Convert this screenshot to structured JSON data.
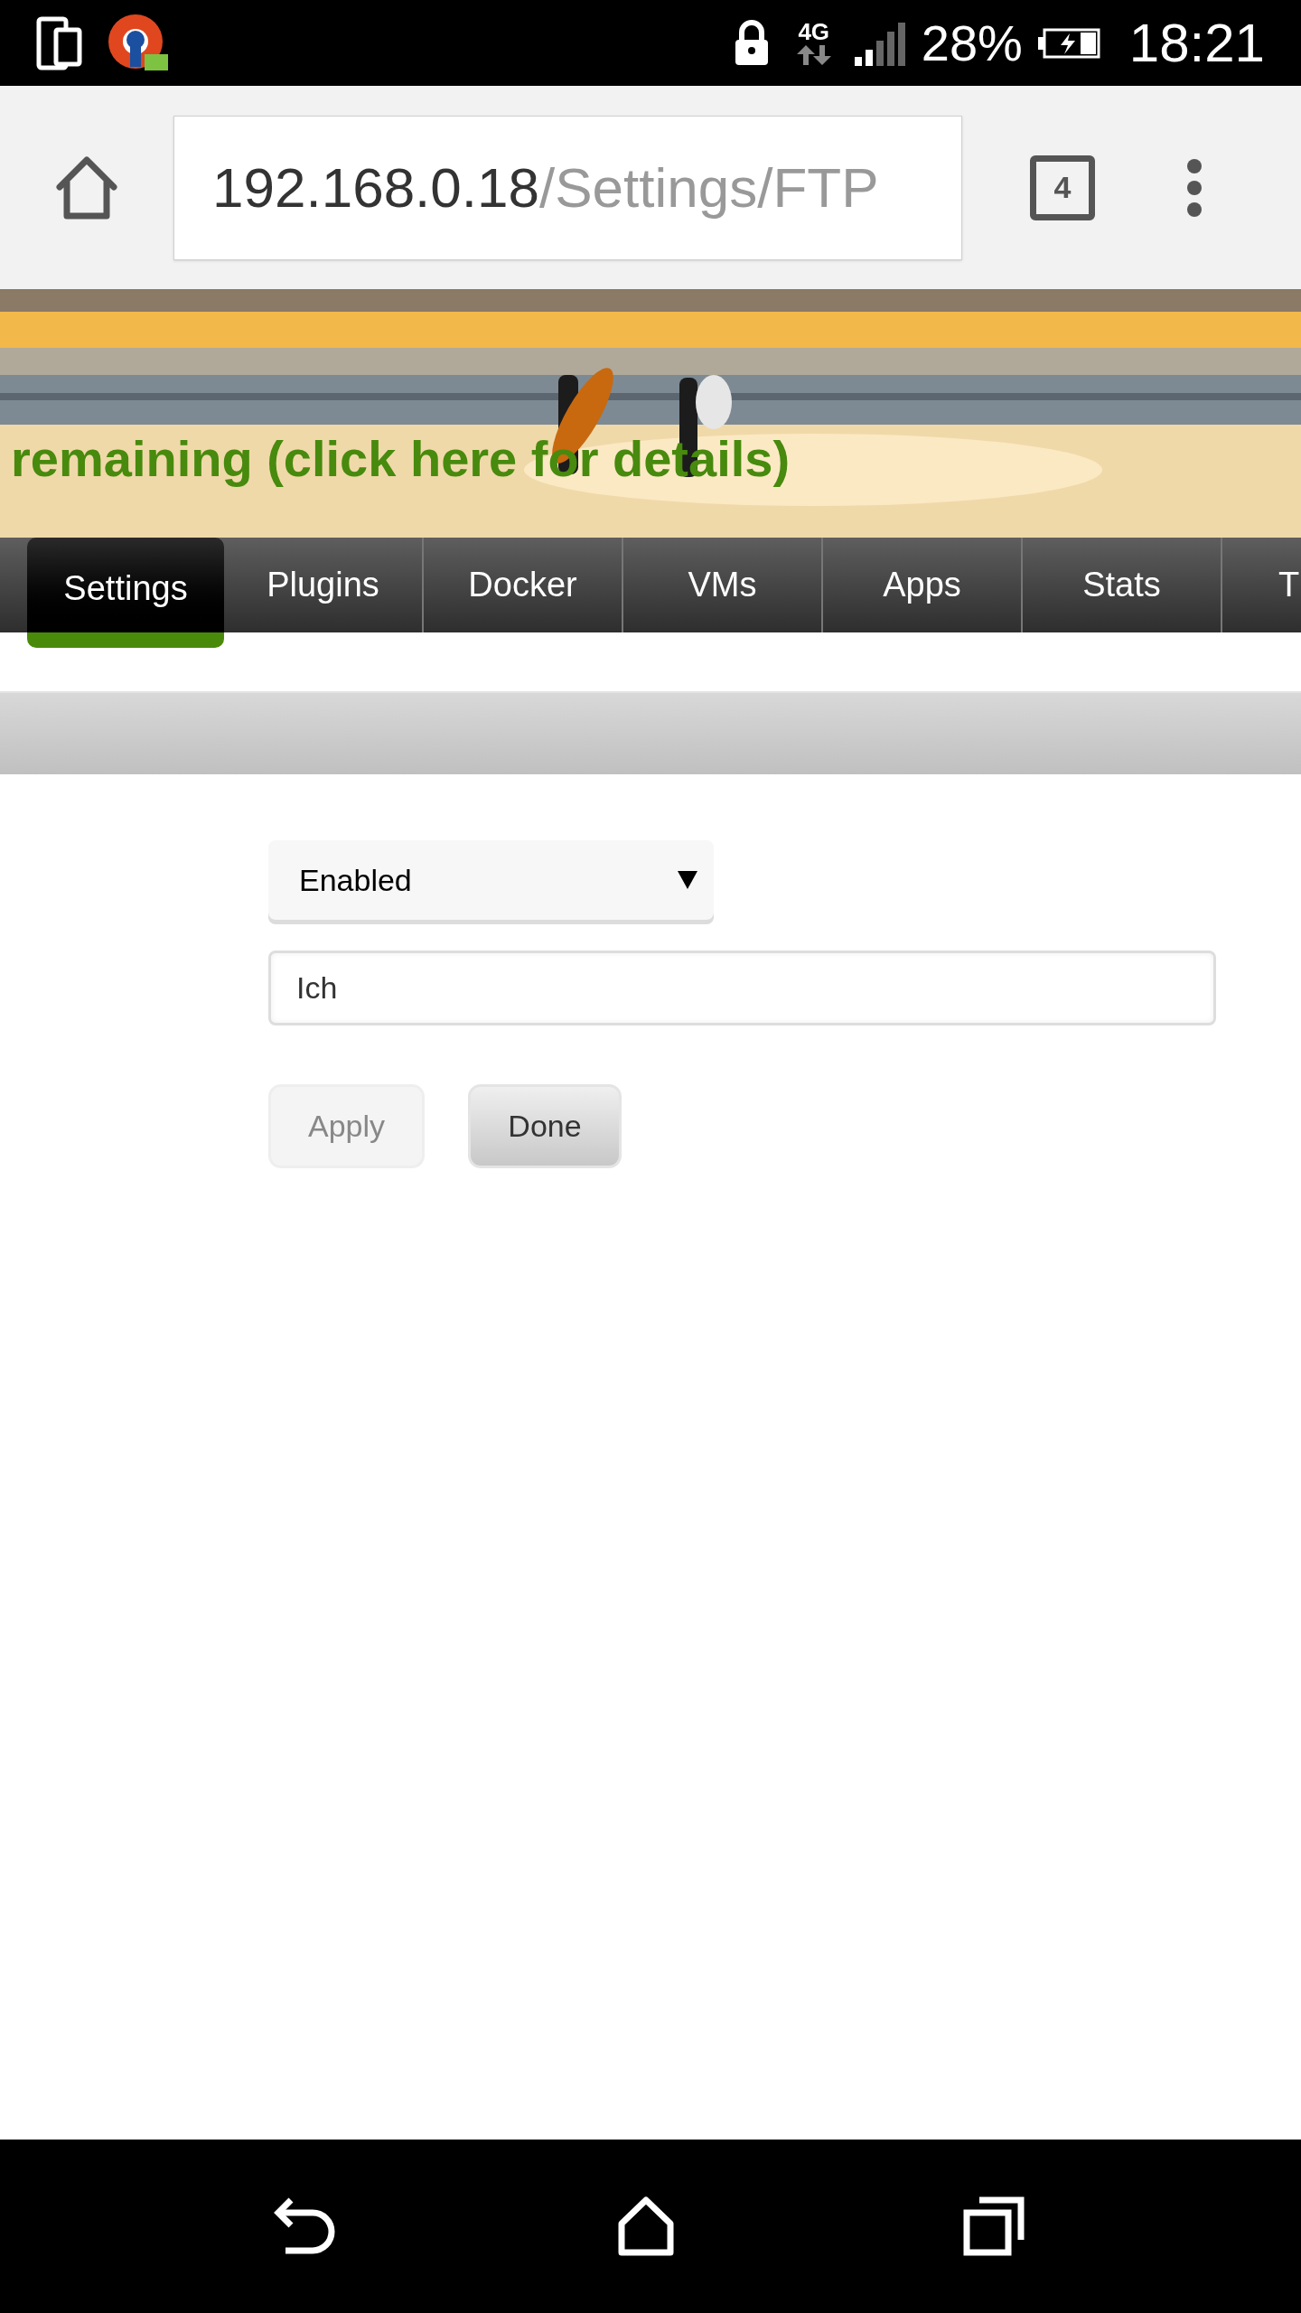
{
  "status_bar": {
    "network": "4G",
    "battery": "28%",
    "time": "18:21"
  },
  "browser": {
    "url_host": "192.168.0.18",
    "url_path": "/Settings/FTP",
    "tab_count": "4"
  },
  "banner": {
    "kind": "picture",
    "notice": "remaining (click here for details)"
  },
  "tabs": [
    {
      "label": "Settings",
      "selected": true
    },
    {
      "label": "Plugins",
      "selected": false
    },
    {
      "label": "Docker",
      "selected": false
    },
    {
      "label": "VMs",
      "selected": false
    },
    {
      "label": "Apps",
      "selected": false
    },
    {
      "label": "Stats",
      "selected": false
    },
    {
      "label": "T",
      "selected": false
    }
  ],
  "form": {
    "select_value": "Enabled",
    "input_value": "Ich",
    "buttons": [
      {
        "label": "Apply",
        "disabled": true
      },
      {
        "label": "Done",
        "disabled": false
      }
    ]
  }
}
